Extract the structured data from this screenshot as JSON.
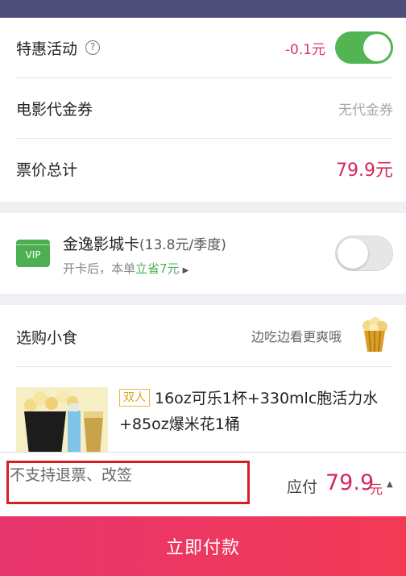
{
  "discount": {
    "label": "特惠活动",
    "value": "-0.1元",
    "toggle_on": true
  },
  "voucher": {
    "label": "电影代金券",
    "value": "无代金券"
  },
  "total": {
    "label": "票价总计",
    "value": "79.9元"
  },
  "vip_card": {
    "badge": "VIP",
    "title": "金逸影城卡",
    "price": "(13.8元/季度)",
    "subtitle": "开卡后，本单",
    "save": "立省7元",
    "toggle_on": false
  },
  "snacks": {
    "title": "选购小食",
    "hint": "边吃边看更爽哦",
    "item": {
      "badge": "双人",
      "name": "16oz可乐1杯+330mlc胞活力水+85oz爆米花1桶"
    }
  },
  "bottom": {
    "refund_notice": "不支持退票、改签",
    "pay_label": "应付",
    "pay_amount": "79.9",
    "pay_unit": "元"
  },
  "pay_button": "立即付款",
  "colors": {
    "accent": "#d6285a",
    "green": "#52b552",
    "header": "#4d4f7a"
  }
}
